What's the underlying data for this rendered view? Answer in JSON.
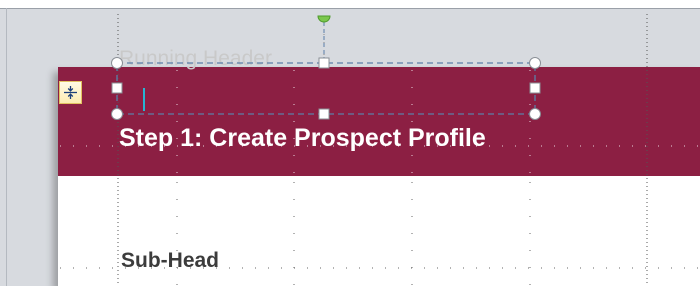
{
  "editor": {
    "running_header_text": "Running Header",
    "title_text": "Step 1: Create Prospect Profile",
    "subhead_text": "Sub-Head",
    "icons": {
      "anchor": "collapse-arrows-icon",
      "rotate": "rotation-handle-icon"
    },
    "colors": {
      "banner": "#8c1f43",
      "workspace": "#d7dadf",
      "cursor": "#27b5d2",
      "rotate_handle": "#7bc74d",
      "selection_border": "#5b7fa8"
    }
  }
}
